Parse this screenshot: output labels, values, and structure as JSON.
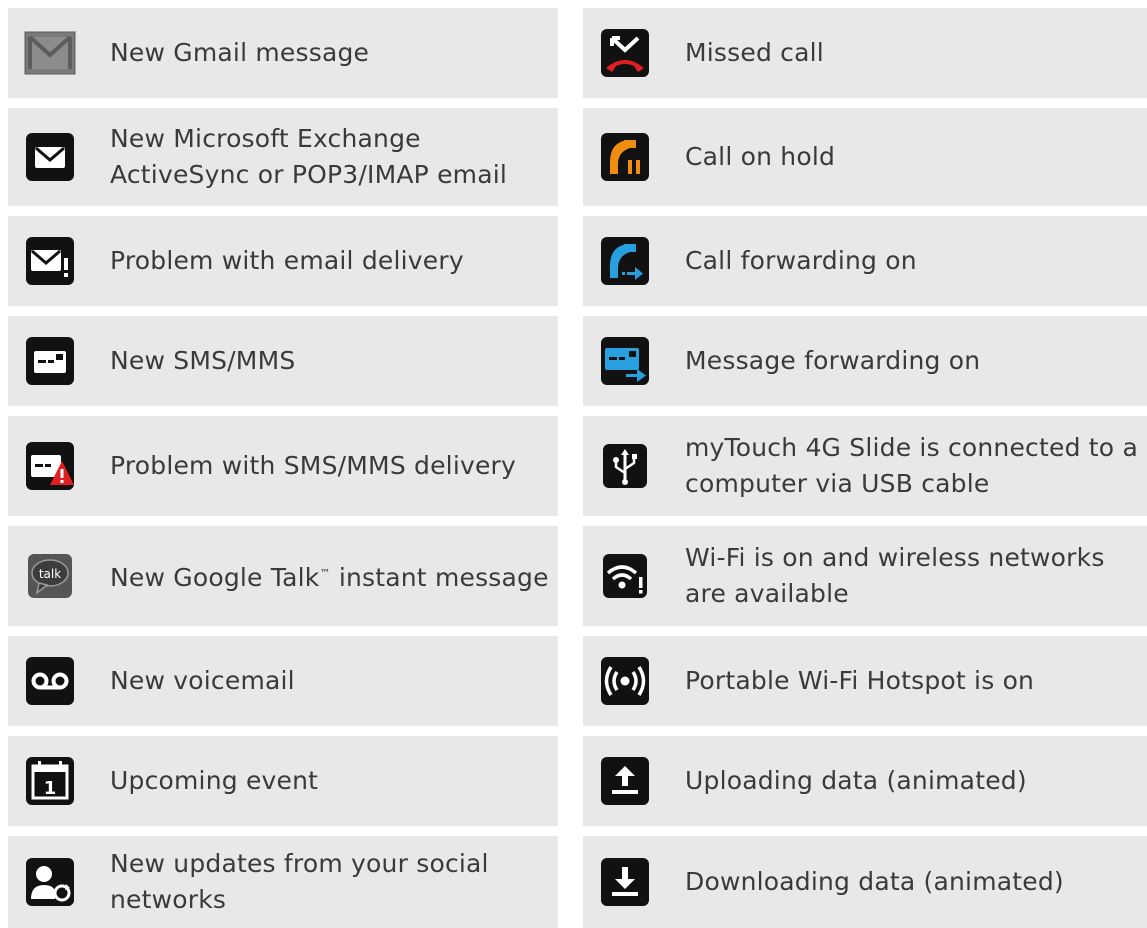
{
  "left_items": [
    {
      "icon": "gmail-icon",
      "label": "New Gmail message"
    },
    {
      "icon": "email-icon",
      "label": "New Microsoft Exchange ActiveSync or POP3/IMAP email"
    },
    {
      "icon": "email-problem-icon",
      "label": "Problem with email delivery"
    },
    {
      "icon": "sms-icon",
      "label": "New SMS/MMS"
    },
    {
      "icon": "sms-problem-icon",
      "label": "Problem with SMS/MMS delivery"
    },
    {
      "icon": "google-talk-icon",
      "label": "New Google Talk™ instant message",
      "icon_text": "talk"
    },
    {
      "icon": "voicemail-icon",
      "label": "New voicemail"
    },
    {
      "icon": "calendar-icon",
      "label": "Upcoming event",
      "icon_text": "1"
    },
    {
      "icon": "social-update-icon",
      "label": "New updates from your social networks"
    }
  ],
  "right_items": [
    {
      "icon": "missed-call-icon",
      "label": "Missed call"
    },
    {
      "icon": "call-hold-icon",
      "label": "Call on hold"
    },
    {
      "icon": "call-forward-icon",
      "label": "Call forwarding on"
    },
    {
      "icon": "message-forward-icon",
      "label": "Message forwarding on"
    },
    {
      "icon": "usb-icon",
      "label": "myTouch 4G Slide is connected to a computer via USB cable"
    },
    {
      "icon": "wifi-available-icon",
      "label": "Wi-Fi is on and wireless networks are available"
    },
    {
      "icon": "hotspot-icon",
      "label": "Portable Wi-Fi Hotspot is on"
    },
    {
      "icon": "upload-icon",
      "label": "Uploading data (animated)"
    },
    {
      "icon": "download-icon",
      "label": "Downloading data (animated)"
    }
  ]
}
